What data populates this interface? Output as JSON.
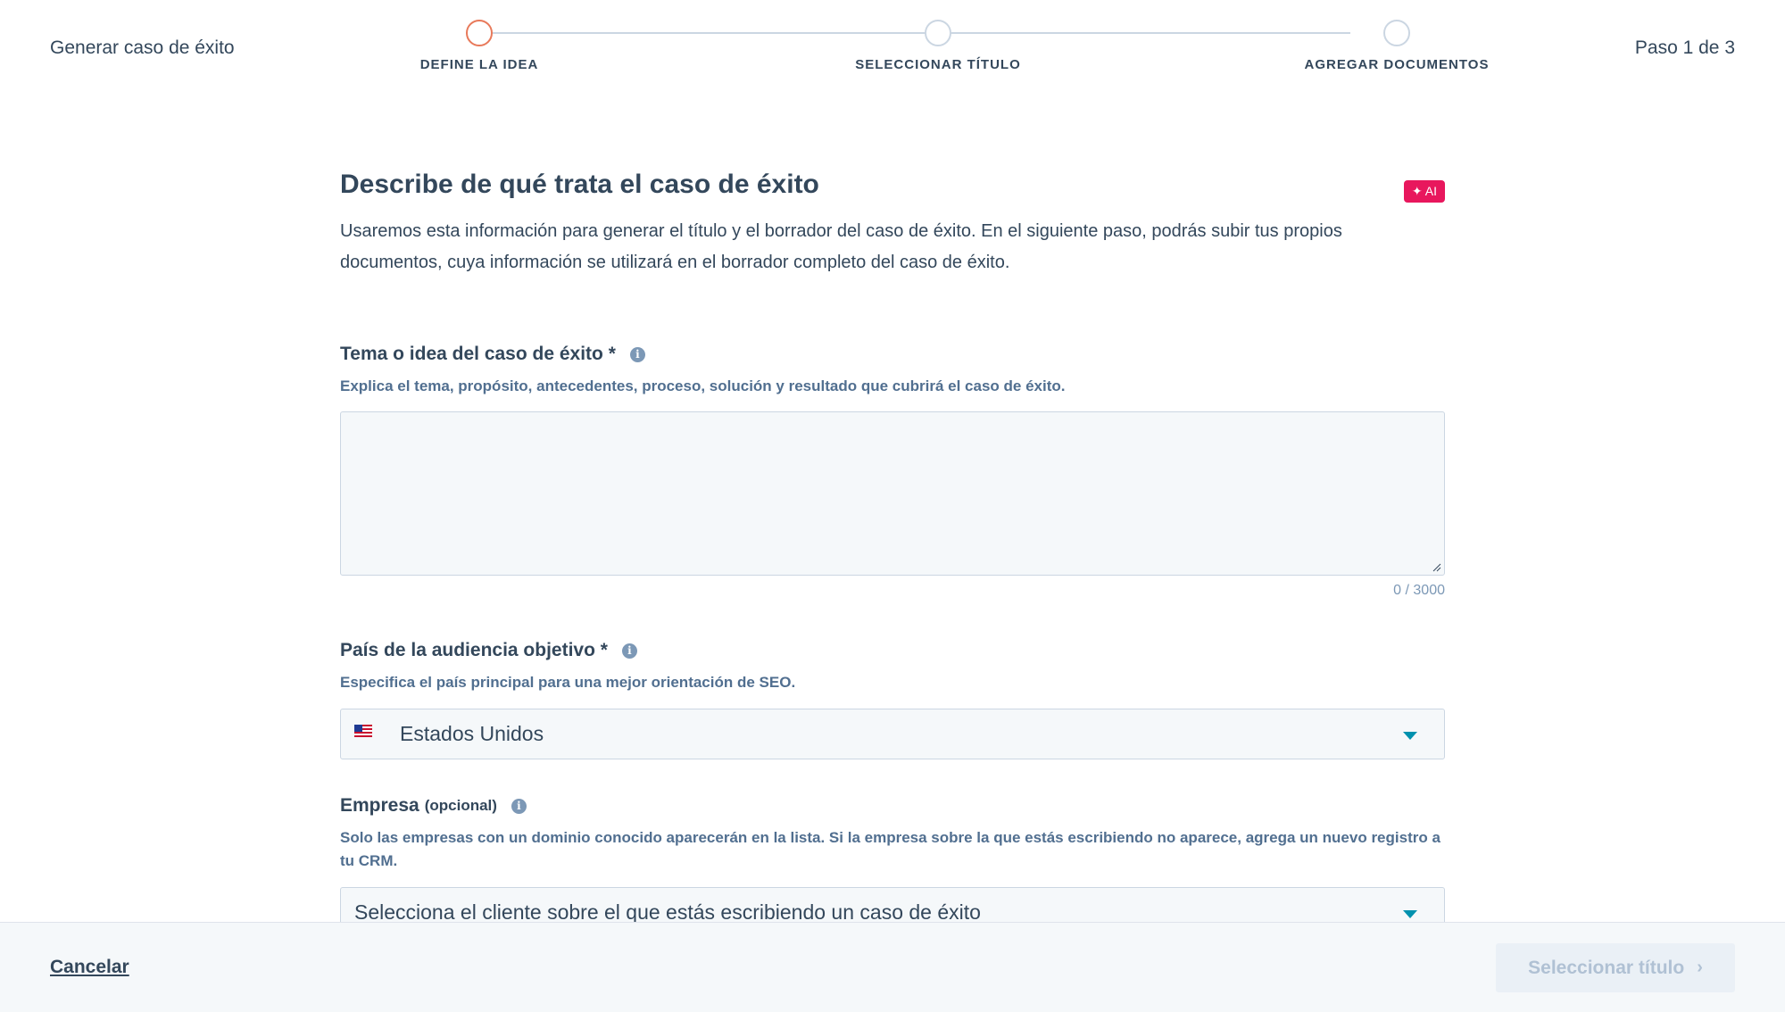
{
  "header": {
    "app_title": "Generar caso de éxito",
    "step_count": "Paso 1 de 3",
    "steps": [
      {
        "label": "DEFINE LA IDEA",
        "active": true
      },
      {
        "label": "SELECCIONAR TÍTULO",
        "active": false
      },
      {
        "label": "AGREGAR DOCUMENTOS",
        "active": false
      }
    ]
  },
  "main": {
    "title": "Describe de qué trata el caso de éxito",
    "ai_badge": "✦ AI",
    "description": "Usaremos esta información para generar el título y el borrador del caso de éxito. En el siguiente paso, podrás subir tus propios documentos, cuya información se utilizará en el borrador completo del caso de éxito.",
    "topic": {
      "label": "Tema o idea del caso de éxito *",
      "help": "Explica el tema, propósito, antecedentes, proceso, solución y resultado que cubrirá el caso de éxito.",
      "value": "",
      "char_count": "0 / 3000"
    },
    "country": {
      "label": "País de la audiencia objetivo *",
      "help": "Especifica el país principal para una mejor orientación de SEO.",
      "selected": "Estados Unidos",
      "flag_icon": "us-flag-icon"
    },
    "company": {
      "label": "Empresa",
      "optional": "(opcional)",
      "help": "Solo las empresas con un dominio conocido aparecerán en la lista. Si la empresa sobre la que estás escribiendo no aparece, agrega un nuevo registro a tu CRM.",
      "placeholder": "Selecciona el cliente sobre el que estás escribiendo un caso de éxito"
    }
  },
  "footer": {
    "cancel_label": "Cancelar",
    "next_label": "Seleccionar título",
    "next_icon": "chevron-right-icon"
  },
  "colors": {
    "text": "#33475b",
    "active_step": "#e8795a",
    "ai_badge": "#e8175d",
    "caret": "#0091ae",
    "field_bg": "#f5f8fa"
  }
}
